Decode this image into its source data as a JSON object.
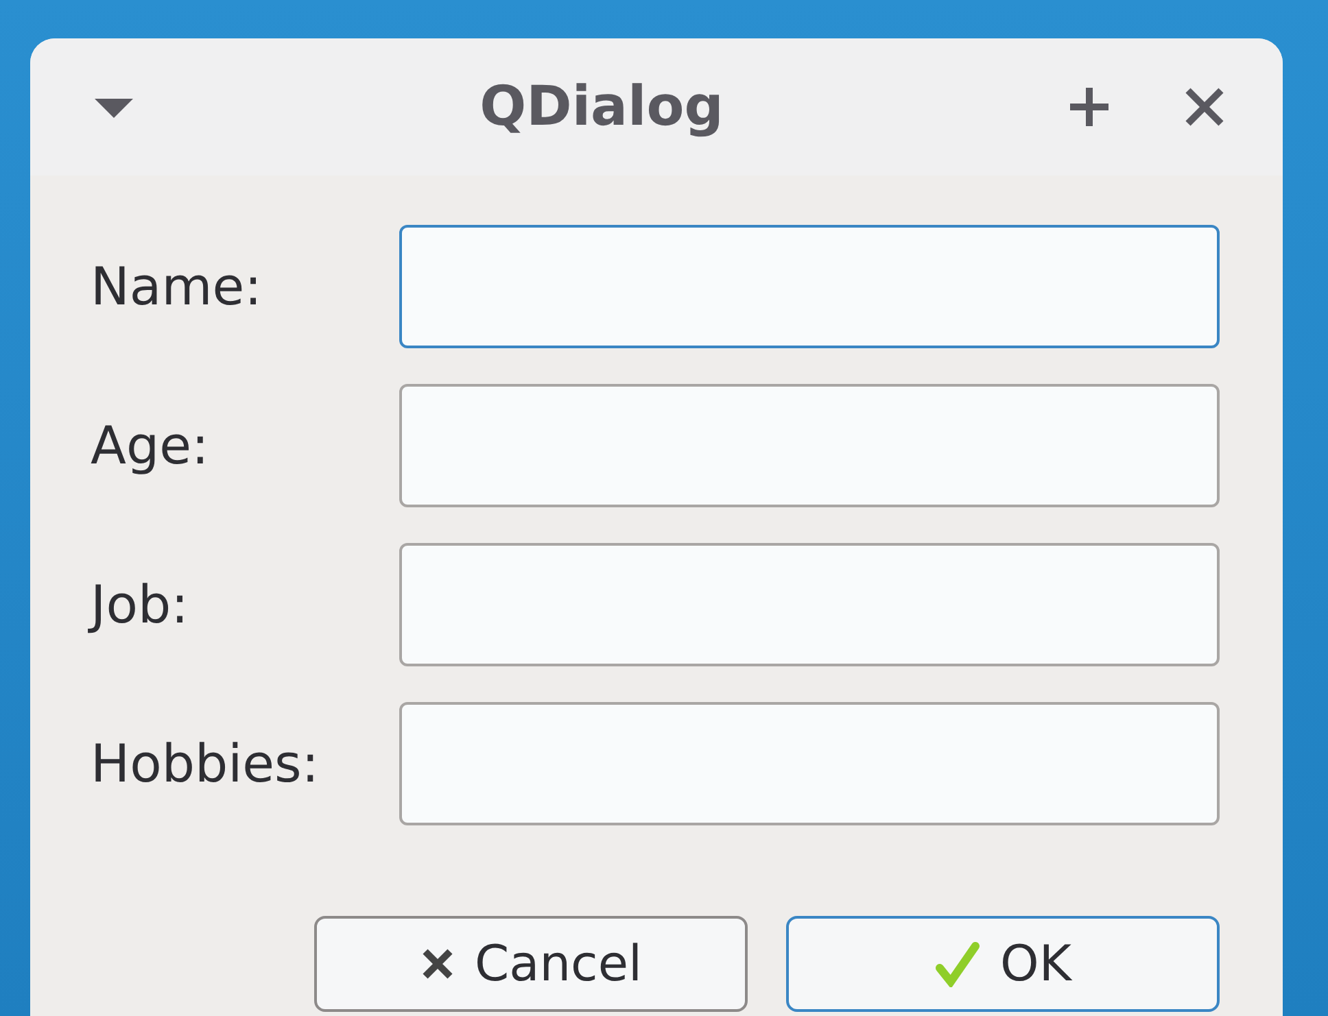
{
  "window": {
    "title": "QDialog"
  },
  "fields": [
    {
      "label": "Name:",
      "focused": true
    },
    {
      "label": "Age:",
      "focused": false
    },
    {
      "label": "Job:",
      "focused": false
    },
    {
      "label": "Hobbies:",
      "focused": false
    }
  ],
  "buttons": [
    {
      "label": "Cancel",
      "kind": "cancel",
      "default": false
    },
    {
      "label": "OK",
      "kind": "ok",
      "default": true
    }
  ]
}
